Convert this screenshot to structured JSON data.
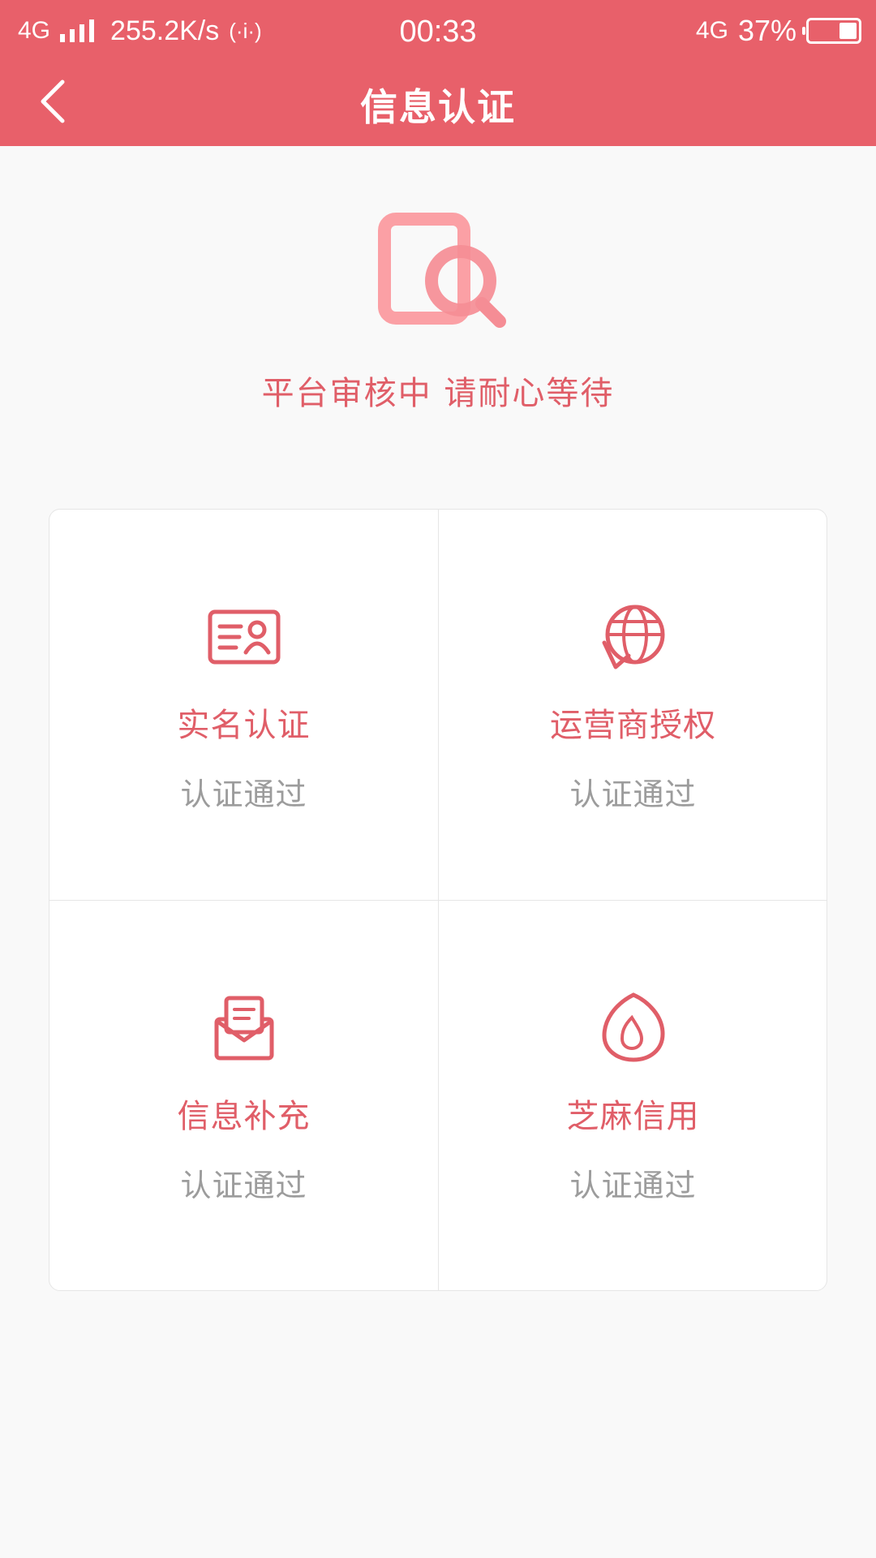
{
  "status_bar": {
    "network_left": "4G",
    "speed": "255.2K/s",
    "hotspot_symbol": "(·i·)",
    "time": "00:33",
    "network_right": "4G",
    "battery_text": "37%",
    "battery_level": 0.37
  },
  "header": {
    "title": "信息认证",
    "back_icon": "chevron-left-icon"
  },
  "review": {
    "icon": "document-search-icon",
    "message": "平台审核中 请耐心等待"
  },
  "colors": {
    "header_bg": "#e8606a",
    "accent": "#e05e68",
    "status_gray": "#9c9c9c",
    "icon_light": "#f9a3a7"
  },
  "items": [
    {
      "title": "实名认证",
      "status": "认证通过",
      "icon": "id-card-icon"
    },
    {
      "title": "运营商授权",
      "status": "认证通过",
      "icon": "globe-icon"
    },
    {
      "title": "信息补充",
      "status": "认证通过",
      "icon": "envelope-icon"
    },
    {
      "title": "芝麻信用",
      "status": "认证通过",
      "icon": "sesame-credit-icon"
    }
  ]
}
